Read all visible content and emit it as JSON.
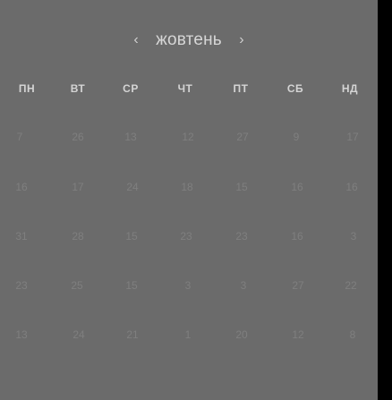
{
  "header": {
    "prev_arrow": "‹",
    "month": "жовтень",
    "next_arrow": "›"
  },
  "weekdays": [
    "ПН",
    "ВТ",
    "СР",
    "ЧТ",
    "ПТ",
    "СБ",
    "НД"
  ],
  "weeks": [
    [
      "7",
      "26",
      "13",
      "12",
      "27",
      "9",
      "17"
    ],
    [
      "16",
      "17",
      "24",
      "18",
      "15",
      "16",
      "16"
    ],
    [
      "31",
      "28",
      "15",
      "23",
      "23",
      "16",
      "3"
    ],
    [
      "23",
      "25",
      "15",
      "3",
      "3",
      "27",
      "22"
    ],
    [
      "13",
      "24",
      "21",
      "1",
      "20",
      "12",
      "8"
    ]
  ],
  "colors": {
    "panel_background": "#6b6b6b",
    "outer_background": "#000000",
    "day_text": "#7f7f7f",
    "header_text": "#d4d4d4"
  }
}
